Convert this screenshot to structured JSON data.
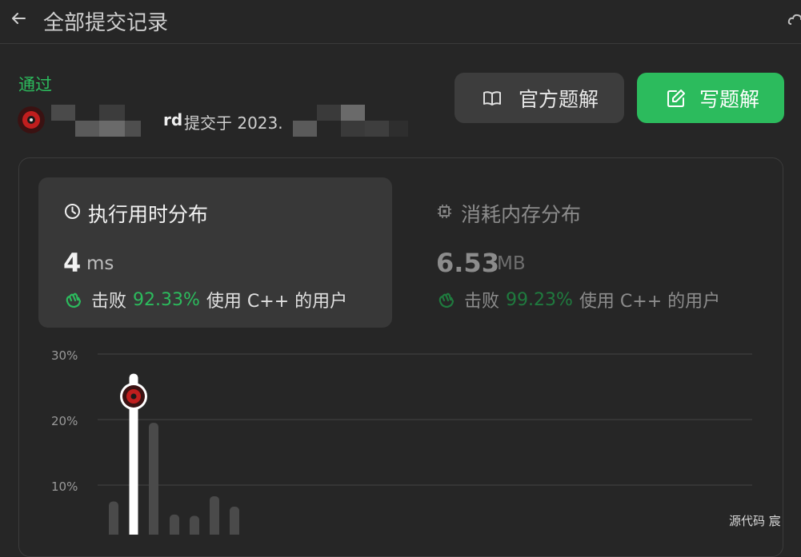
{
  "header": {
    "title": "全部提交记录"
  },
  "submission": {
    "status": "通过",
    "user_suffix": "rd",
    "submitted_prefix": "提交于 2023."
  },
  "buttons": {
    "official_solution": "官方题解",
    "write_solution": "写题解"
  },
  "runtime": {
    "title": "执行用时分布",
    "value": "4",
    "unit": "ms",
    "beats_label": "击败",
    "beats_pct": "92.33%",
    "beats_suffix": "使用 C++ 的用户"
  },
  "memory": {
    "title": "消耗内存分布",
    "value": "6.53",
    "unit": "MB",
    "beats_label": "击败",
    "beats_pct": "99.23%",
    "beats_suffix": "使用 C++ 的用户"
  },
  "colors": {
    "accent_green": "#2cbb5d",
    "background": "#262626",
    "card": "#383838"
  },
  "chart_data": {
    "type": "bar",
    "y_ticks": [
      "30%",
      "20%",
      "10%"
    ],
    "ylim": [
      0,
      30
    ],
    "series": [
      {
        "values": [
          7.5,
          27,
          19.5,
          5.5,
          5.3,
          8.3,
          6.7,
          0.5
        ]
      }
    ],
    "highlight_index": 1,
    "grid": true
  },
  "watermark": "源代码 宸"
}
